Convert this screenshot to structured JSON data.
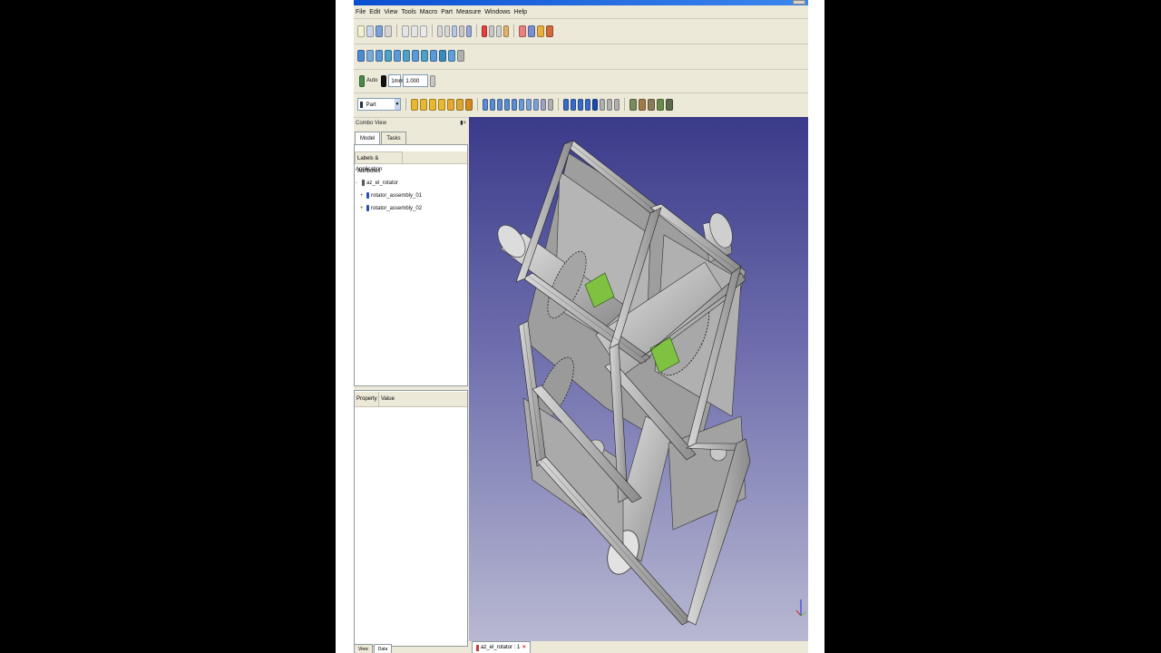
{
  "app": {
    "menu": [
      "File",
      "Edit",
      "View",
      "Tools",
      "Macro",
      "Part",
      "Measure",
      "Windows",
      "Help"
    ],
    "toolbar_row3": {
      "auto_label": "Auto",
      "spin1": "1mm",
      "spin2": "1.000"
    },
    "workbench_combo": "Part"
  },
  "combo_view": {
    "title": "Combo View",
    "tabs": [
      {
        "label": "Model"
      },
      {
        "label": "Tasks"
      }
    ],
    "labels_header": "Labels & Attributes",
    "tree": {
      "root": "Application",
      "document": "az_el_rotator",
      "children": [
        "rotator_assembly_01",
        "rotator_assembly_02"
      ]
    },
    "property_header": {
      "property": "Property",
      "value": "Value"
    },
    "bottom_tabs": [
      {
        "label": "View"
      },
      {
        "label": "Data"
      }
    ]
  },
  "viewport": {
    "doc_tab_label": "az_el_rotator : 1"
  },
  "colors": {
    "accent_green": "#7fc241",
    "frame_gray": "#a9a9a9",
    "bg_top": "#3a3a8a",
    "bg_bottom": "#b8b8d2"
  }
}
